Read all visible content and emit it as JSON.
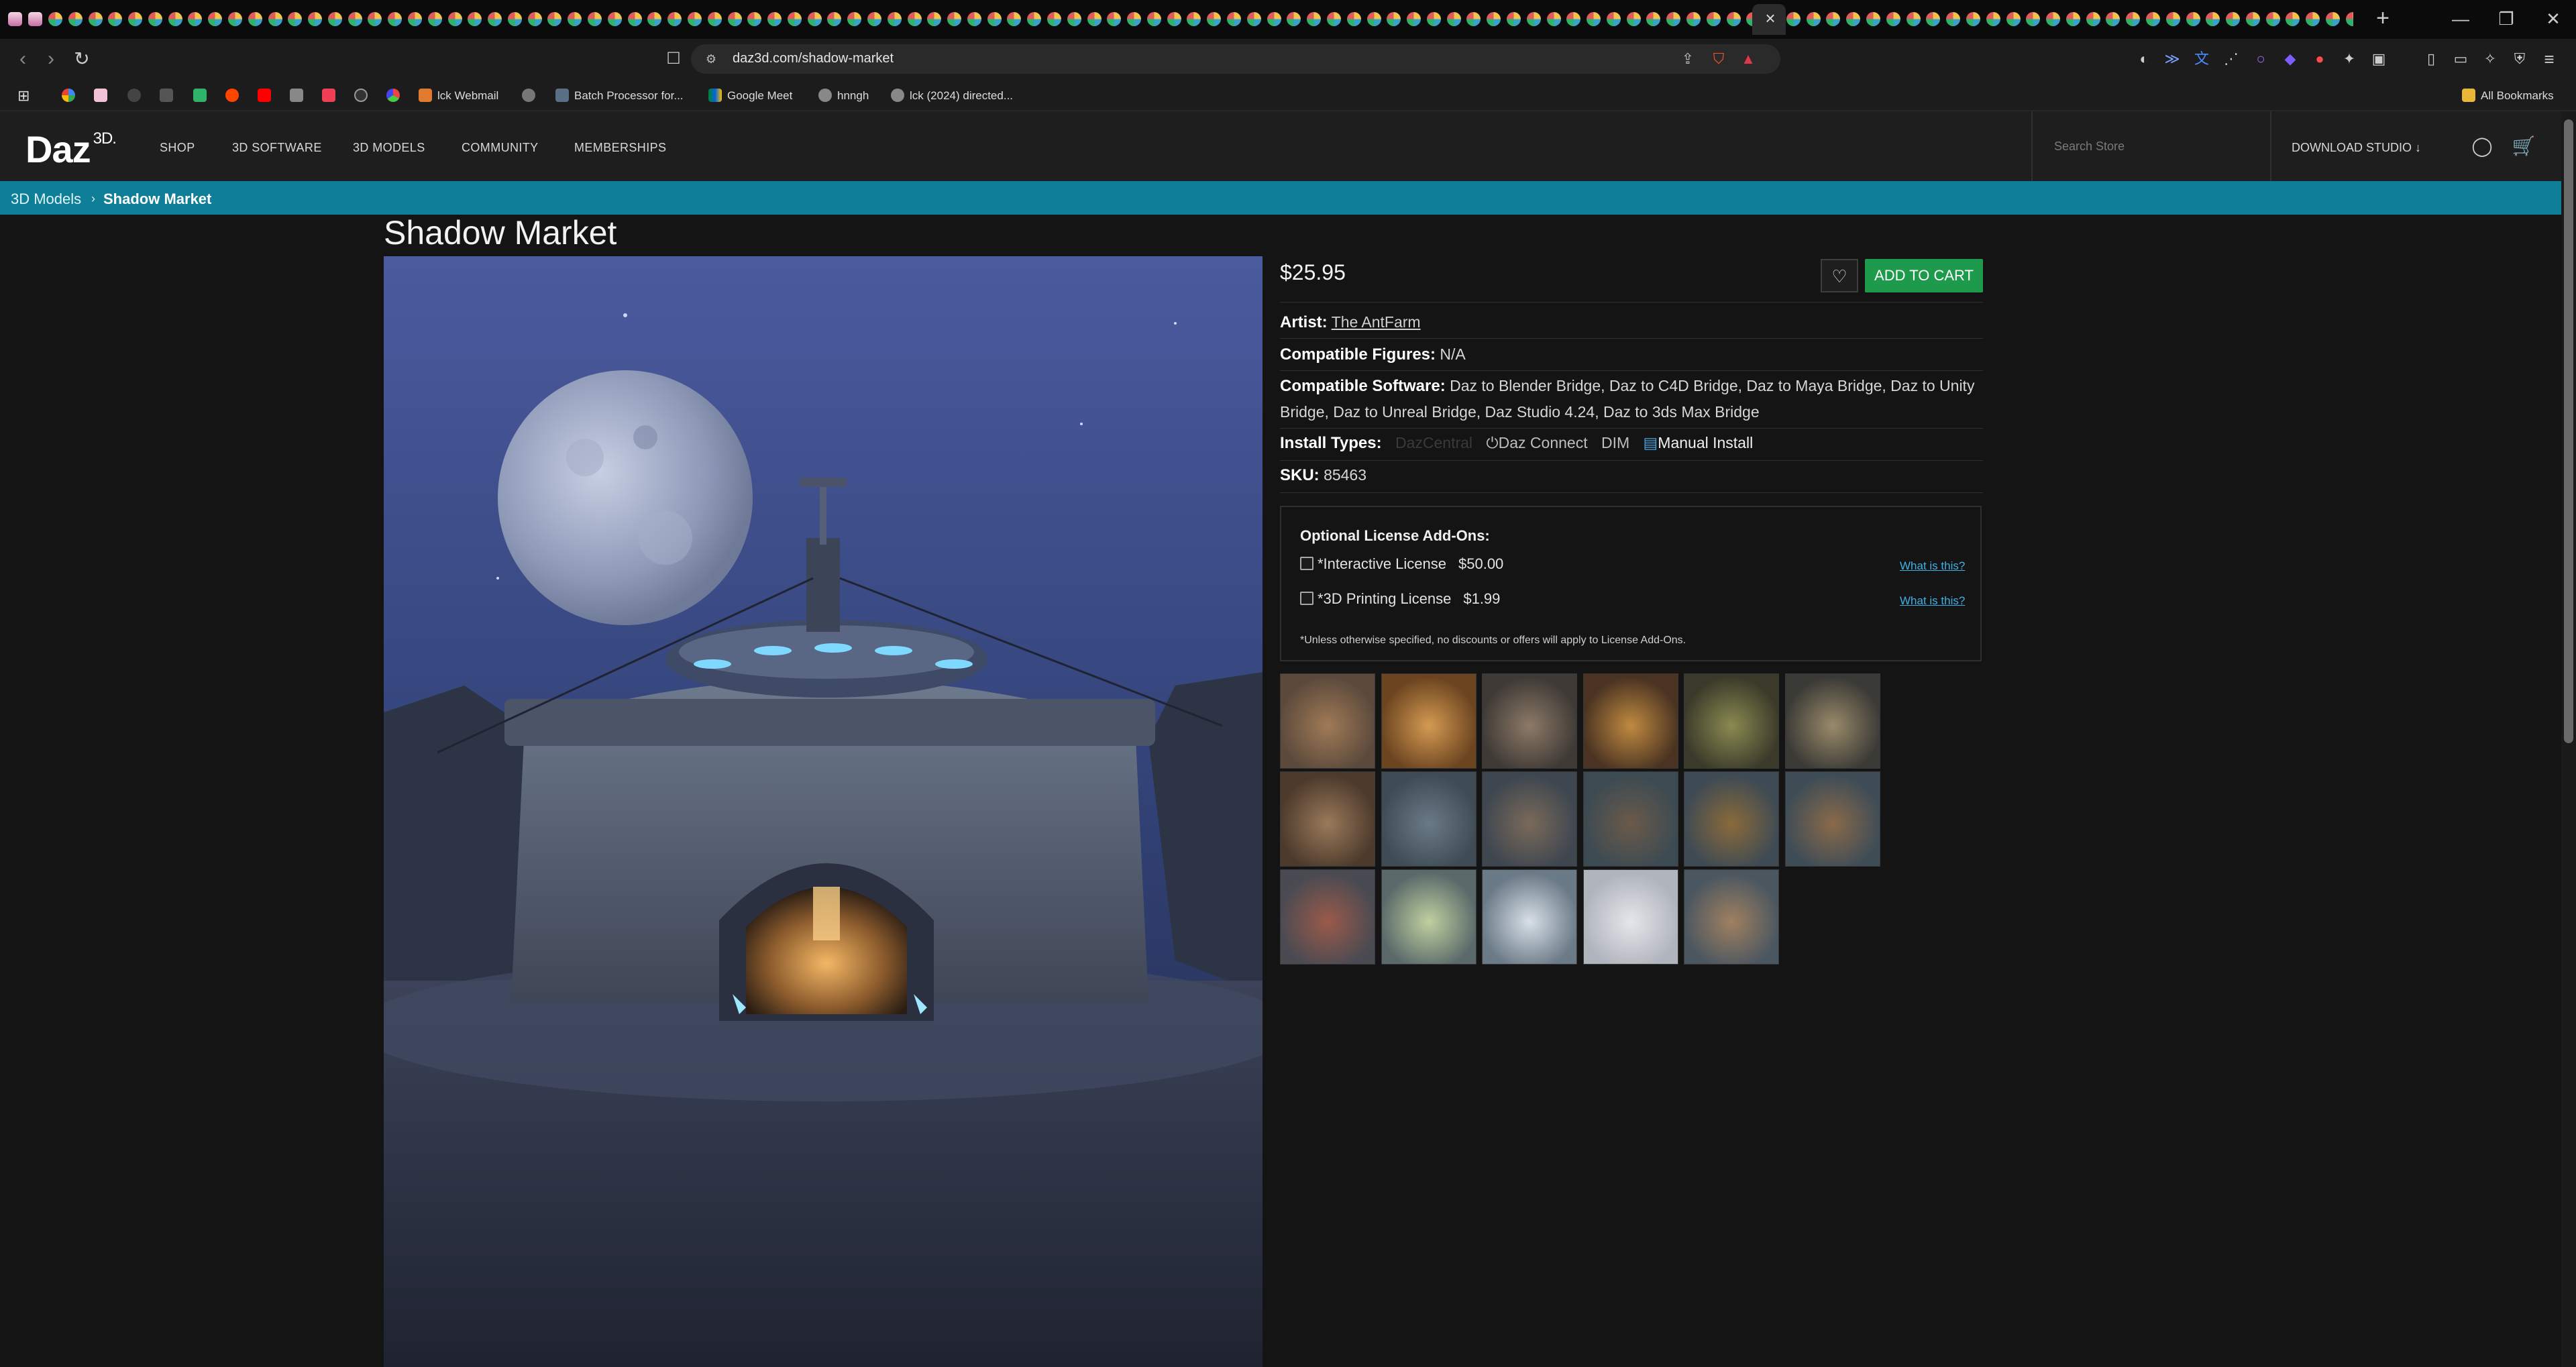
{
  "browser": {
    "url": "daz3d.com/shadow-market",
    "tab_close_glyph": "×",
    "new_tab_glyph": "+",
    "window_controls": [
      "—",
      "❐",
      "✕"
    ],
    "bookmarks": [
      {
        "label": "lck Webmail",
        "icon": "mail-icon"
      },
      {
        "label": "Batch Processor for...",
        "icon": "web-icon"
      },
      {
        "label": "Google Meet",
        "icon": "meet-icon"
      },
      {
        "label": "hnngh",
        "icon": "globe-icon"
      },
      {
        "label": "lck (2024) directed...",
        "icon": "globe-icon"
      }
    ],
    "all_bookmarks": "All Bookmarks"
  },
  "site": {
    "logo": "Daz",
    "logo_sup": "3D.",
    "nav": [
      "SHOP",
      "3D SOFTWARE",
      "3D MODELS",
      "COMMUNITY",
      "MEMBERSHIPS"
    ],
    "search_placeholder": "Search Store",
    "download_studio": "DOWNLOAD STUDIO ↓"
  },
  "breadcrumb": {
    "parent": "3D Models",
    "separator": "›",
    "current": "Shadow Market"
  },
  "product": {
    "title": "Shadow Market",
    "price": "$25.95",
    "add_to_cart": "ADD TO CART",
    "artist_label": "Artist:",
    "artist": "The AntFarm",
    "figures_label": "Compatible Figures:",
    "figures": "N/A",
    "software_label": "Compatible Software:",
    "software": "Daz to Blender Bridge, Daz to C4D Bridge, Daz to Maya Bridge, Daz to Unity Bridge, Daz to Unreal Bridge, Daz Studio 4.24, Daz to 3ds Max Bridge",
    "install_label": "Install Types:",
    "install_types": [
      "DazCentral",
      "Daz Connect",
      "DIM",
      "Manual Install"
    ],
    "sku_label": "SKU:",
    "sku": "85463"
  },
  "license": {
    "heading": "Optional License Add-Ons:",
    "items": [
      {
        "name": "*Interactive License",
        "price": "$50.00",
        "link": "What is this?"
      },
      {
        "name": "*3D Printing License",
        "price": "$1.99",
        "link": "What is this?"
      }
    ],
    "note": "*Unless otherwise specified, no discounts or offers will apply to License Add-Ons."
  },
  "colors": {
    "accent_teal": "#0f7e97",
    "cart_green": "#1d9a4b",
    "link_blue": "#3fb1e6"
  }
}
